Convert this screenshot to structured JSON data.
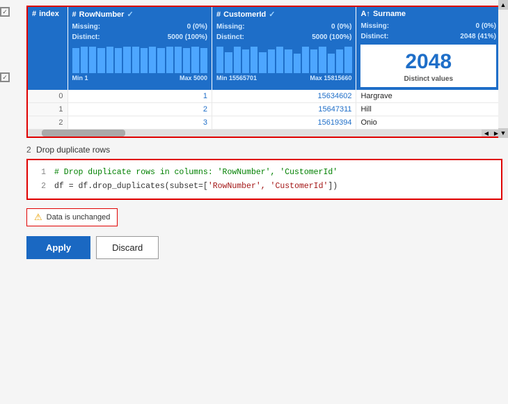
{
  "colors": {
    "header_bg": "#1e6ec8",
    "index_bg": "#4a4a5a",
    "border_red": "#e00000",
    "btn_apply_bg": "#1a68c2",
    "distinct_blue": "#1e6ec8"
  },
  "table": {
    "columns": [
      {
        "id": "index",
        "label": "index",
        "icon": "#",
        "type": "index"
      },
      {
        "id": "RowNumber",
        "label": "RowNumber",
        "icon": "#",
        "type": "numeric",
        "missing": "0 (0%)",
        "distinct": "5000 (100%)",
        "min_label": "Min 1",
        "max_label": "Max 5000",
        "bars": [
          8,
          9,
          9,
          8,
          9,
          8,
          9,
          9,
          8,
          9,
          8,
          9,
          9,
          8,
          9,
          8,
          9,
          8,
          9,
          9,
          8,
          9,
          8
        ]
      },
      {
        "id": "CustomerId",
        "label": "CustomerId",
        "icon": "#",
        "type": "numeric",
        "missing": "0 (0%)",
        "distinct": "5000 (100%)",
        "min_label": "Min 15565701",
        "max_label": "Max 15815660",
        "bars": [
          9,
          7,
          9,
          8,
          9,
          7,
          8,
          9,
          8,
          7,
          9,
          8,
          9,
          7,
          8,
          9,
          8,
          7,
          9,
          8,
          9,
          7,
          8
        ]
      },
      {
        "id": "Surname",
        "label": "Surname",
        "icon": "A↑",
        "type": "text",
        "missing": "0 (0%)",
        "distinct": "2048 (41%)",
        "distinct_count": "2048",
        "distinct_label": "Distinct values"
      }
    ],
    "rows": [
      {
        "index": "0",
        "RowNumber": "1",
        "CustomerId": "15634602",
        "Surname": "Hargrave"
      },
      {
        "index": "1",
        "RowNumber": "2",
        "CustomerId": "15647311",
        "Surname": "Hill"
      },
      {
        "index": "2",
        "RowNumber": "3",
        "CustomerId": "15619394",
        "Surname": "Onio"
      }
    ]
  },
  "step": {
    "number": "2",
    "label": "Drop duplicate rows"
  },
  "code": {
    "line1_num": "1",
    "line1": "# Drop duplicate rows in columns: 'RowNumber', 'CustomerId'",
    "line2_num": "2",
    "line2_prefix": "df = df.drop_duplicates(subset=[",
    "line2_args": "'RowNumber', 'CustomerId'",
    "line2_suffix": "])"
  },
  "status": {
    "icon": "⚠",
    "text": "Data is unchanged"
  },
  "buttons": {
    "apply": "Apply",
    "discard": "Discard"
  }
}
